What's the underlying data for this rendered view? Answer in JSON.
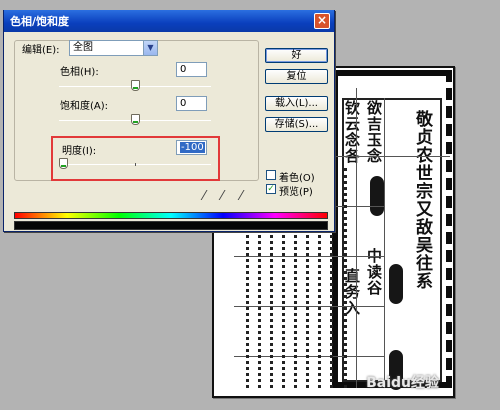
{
  "dialog": {
    "title": "色相/饱和度",
    "close_symbol": "×",
    "edit_label": "编辑(E):",
    "edit_value": "全图",
    "hue": {
      "label": "色相(H):",
      "value": "0",
      "level": 0.5
    },
    "saturation": {
      "label": "饱和度(A):",
      "value": "0",
      "level": 0.5
    },
    "lightness": {
      "label": "明度(I):",
      "value": "-100",
      "level": 0.0
    },
    "buttons": {
      "ok": "好",
      "reset": "复位",
      "load": "载入(L)...",
      "save": "存储(S)..."
    },
    "colorize": {
      "label": "着色(O)",
      "checked": false
    },
    "preview": {
      "label": "预览(P)",
      "checked": true
    }
  },
  "background_doc": {
    "col_a": "敬贞农世宗又敌吴往系",
    "col_b": "欲吉玉念",
    "col_c": "钦云念各",
    "col_d": "中读谷",
    "col_e": "直务入",
    "watermark": "Baidu经验"
  },
  "colors": {
    "highlight": "#e23939",
    "title_bar": "#0a3fbd"
  }
}
